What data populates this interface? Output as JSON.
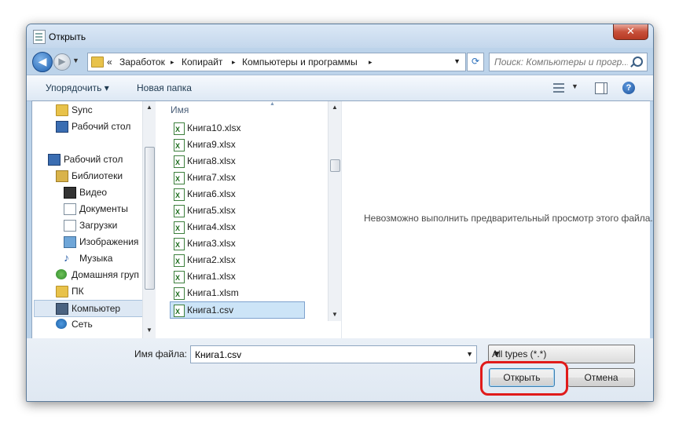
{
  "window": {
    "title": "Открыть",
    "close_label": "✕"
  },
  "address": {
    "breadcrumb_prefix": "«",
    "crumbs": [
      "Заработок",
      "Копирайт",
      "Компьютеры и программы"
    ],
    "separator": "▸",
    "search_placeholder": "Поиск: Компьютеры и прогр..."
  },
  "toolbar": {
    "organize_label": "Упорядочить ▾",
    "new_folder_label": "Новая папка"
  },
  "nav": {
    "items": [
      {
        "label": "Sync",
        "icon": "folder-icon"
      },
      {
        "label": "Рабочий стол",
        "icon": "monitor-icon"
      },
      {
        "label": "Рабочий стол",
        "icon": "monitor-icon"
      },
      {
        "label": "Библиотеки",
        "icon": "library-icon"
      },
      {
        "label": "Видео",
        "icon": "film-icon"
      },
      {
        "label": "Документы",
        "icon": "document-icon"
      },
      {
        "label": "Загрузки",
        "icon": "document-icon"
      },
      {
        "label": "Изображения",
        "icon": "picture-icon"
      },
      {
        "label": "Музыка",
        "icon": "music-icon"
      },
      {
        "label": "Домашняя груп",
        "icon": "homegroup-icon"
      },
      {
        "label": "ПК",
        "icon": "pc-icon"
      },
      {
        "label": "Компьютер",
        "icon": "computer-icon"
      },
      {
        "label": "Сеть",
        "icon": "network-icon"
      }
    ]
  },
  "files": {
    "column_header": "Имя",
    "items": [
      "Книга10.xlsx",
      "Книга9.xlsx",
      "Книга8.xlsx",
      "Книга7.xlsx",
      "Книга6.xlsx",
      "Книга5.xlsx",
      "Книга4.xlsx",
      "Книга3.xlsx",
      "Книга2.xlsx",
      "Книга1.xlsx",
      "Книга1.xlsm",
      "Книга1.csv"
    ],
    "selected": "Книга1.csv"
  },
  "preview": {
    "message": "Невозможно выполнить предварительный просмотр этого файла."
  },
  "bottom": {
    "filename_label": "Имя файла:",
    "filename_value": "Книга1.csv",
    "file_type": "All types (*.*)",
    "open_label": "Открыть",
    "cancel_label": "Отмена"
  },
  "colors": {
    "highlight": "#e01b1b",
    "selection": "#cce4f7"
  }
}
